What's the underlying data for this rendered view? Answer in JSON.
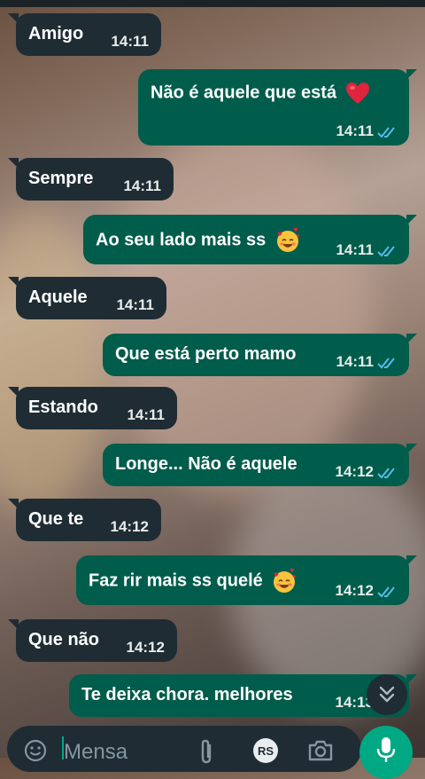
{
  "messages": [
    {
      "dir": "in",
      "text": "Amigo",
      "time": "14:11"
    },
    {
      "dir": "out",
      "text": "Não é aquele que está",
      "emoji": "red-heart",
      "time": "14:11",
      "status": "read"
    },
    {
      "dir": "in",
      "text": "Sempre",
      "time": "14:11"
    },
    {
      "dir": "out",
      "text": "Ao seu lado mais ss",
      "emoji": "smiling-face-with-hearts",
      "time": "14:11",
      "status": "read"
    },
    {
      "dir": "in",
      "text": "Aquele",
      "time": "14:11"
    },
    {
      "dir": "out",
      "text": "Que está perto mamo",
      "time": "14:11",
      "status": "read"
    },
    {
      "dir": "in",
      "text": "Estando",
      "time": "14:11"
    },
    {
      "dir": "out",
      "text": "Longe... Não é aquele",
      "time": "14:12",
      "status": "read"
    },
    {
      "dir": "in",
      "text": "Que te",
      "time": "14:12"
    },
    {
      "dir": "out",
      "text": "Faz rir mais ss quelé",
      "emoji": "smiling-face-with-hearts",
      "time": "14:12",
      "status": "read"
    },
    {
      "dir": "in",
      "text": "Que não",
      "time": "14:12"
    },
    {
      "dir": "out",
      "text": "Te deixa chora. melhores",
      "time": "14:13"
    }
  ],
  "composer": {
    "placeholder": "Mensa"
  },
  "colors": {
    "incoming": "#1f2c34",
    "outgoing": "#005c4b",
    "read_tick": "#53bdeb",
    "accent": "#00a884"
  }
}
